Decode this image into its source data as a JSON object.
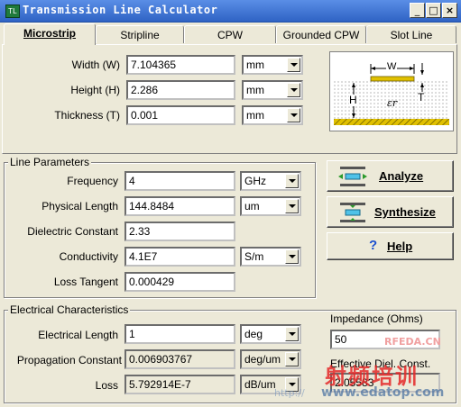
{
  "window": {
    "title": "Transmission Line Calculator"
  },
  "tabs": [
    {
      "label": "Microstrip",
      "active": true
    },
    {
      "label": "Stripline"
    },
    {
      "label": "CPW"
    },
    {
      "label": "Grounded CPW"
    },
    {
      "label": "Slot Line"
    }
  ],
  "geometry": {
    "width": {
      "label": "Width (W)",
      "value": "7.104365",
      "unit": "mm"
    },
    "height": {
      "label": "Height (H)",
      "value": "2.286",
      "unit": "mm"
    },
    "thickness": {
      "label": "Thickness (T)",
      "value": "0.001",
      "unit": "mm"
    }
  },
  "diagram": {
    "w": "W",
    "h": "H",
    "t": "T",
    "er": "εr"
  },
  "line_params": {
    "title": "Line Parameters",
    "frequency": {
      "label": "Frequency",
      "value": "4",
      "unit": "GHz"
    },
    "physical_length": {
      "label": "Physical Length",
      "value": "144.8484",
      "unit": "um"
    },
    "dielectric": {
      "label": "Dielectric Constant",
      "value": "2.33"
    },
    "conductivity": {
      "label": "Conductivity",
      "value": "4.1E7",
      "unit": "S/m"
    },
    "loss_tangent": {
      "label": "Loss Tangent",
      "value": "0.000429"
    }
  },
  "buttons": {
    "analyze": "Analyze",
    "synthesize": "Synthesize",
    "help": "Help"
  },
  "electrical": {
    "title": "Electrical Characteristics",
    "electrical_length": {
      "label": "Electrical Length",
      "value": "1",
      "unit": "deg"
    },
    "propagation": {
      "label": "Propagation Constant",
      "value": "0.006903767",
      "unit": "deg/um"
    },
    "loss": {
      "label": "Loss",
      "value": "5.792914E-7",
      "unit": "dB/um"
    }
  },
  "impedance": {
    "label": "Impedance (Ohms)",
    "value": "50",
    "eff_label": "Effective Diel. Const.",
    "eff_value": "2.05583"
  },
  "watermark": {
    "text1": "RFEDA.CN",
    "text2": "射频培训",
    "text3": "www.edatop.com",
    "text4": "http://"
  }
}
